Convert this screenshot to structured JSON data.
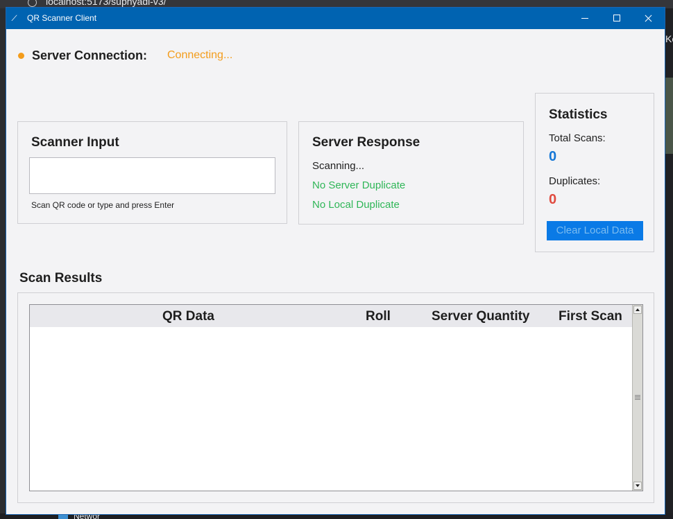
{
  "browser": {
    "url_text": "localhost:5173/suphyadi-v3/",
    "edge_label": "Ke",
    "taskbar_label": "Networ"
  },
  "window": {
    "title": "QR Scanner Client",
    "icon": "feather-icon"
  },
  "connection": {
    "label": "Server Connection:",
    "status": "Connecting...",
    "status_color": "#f39c1b"
  },
  "scanner": {
    "title": "Scanner Input",
    "input_value": "",
    "hint": "Scan QR code or type and press Enter"
  },
  "response": {
    "title": "Server Response",
    "lines": [
      "Scanning...",
      "No Server Duplicate",
      "No Local Duplicate"
    ]
  },
  "stats": {
    "title": "Statistics",
    "total_label": "Total Scans:",
    "total_value": "0",
    "duplicates_label": "Duplicates:",
    "duplicates_value": "0",
    "clear_button": "Clear Local Data"
  },
  "results": {
    "title": "Scan Results",
    "columns": [
      "QR Data",
      "Roll",
      "Server Quantity",
      "First Scan"
    ],
    "rows": []
  },
  "colors": {
    "titlebar": "#0063b1",
    "accent_blue": "#1577d6",
    "success_green": "#2fb657",
    "error_red": "#e04a3f",
    "warning_orange": "#f39c1b"
  }
}
